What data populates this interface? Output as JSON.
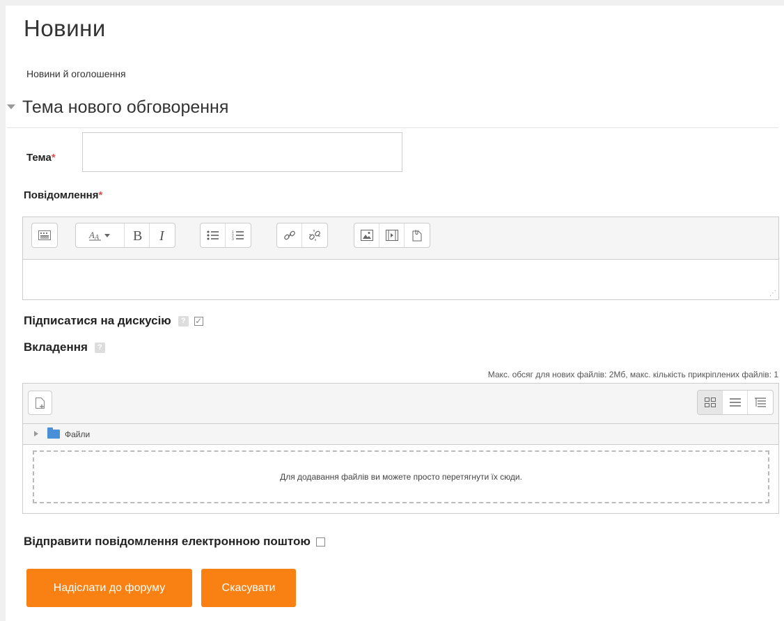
{
  "forum": {
    "title": "Новини",
    "subtitle": "Новини й оголошення"
  },
  "section": {
    "title": "Тема нового обговорення"
  },
  "form": {
    "topic_label": "Тема",
    "message_label": "Повідомлення",
    "required_marker": "*",
    "subscribe_label": "Підписатися на дискусію",
    "subscribe_checked": true,
    "attachments_label": "Вкладення",
    "email_label": "Відправити повідомлення електронною поштою",
    "email_checked": false,
    "help_glyph": "?"
  },
  "editor": {
    "toolbar_groups": [
      [
        "keyboard-icon"
      ],
      [
        "font-style-dropdown-icon",
        "bold-icon",
        "italic-icon"
      ],
      [
        "bullet-list-icon",
        "numbered-list-icon"
      ],
      [
        "link-icon",
        "unlink-icon"
      ],
      [
        "image-icon",
        "media-icon",
        "manage-files-icon"
      ]
    ]
  },
  "filemanager": {
    "limits_text": "Макс. обсяг для нових файлів: 2Мб, макс. кількість прикріплених файлів: 1",
    "folder_label": "Файли",
    "drop_text": "Для додавання файлів ви можете просто перетягнути їх сюди.",
    "view_buttons": [
      "icons-view-icon",
      "list-view-icon",
      "tree-view-icon"
    ]
  },
  "buttons": {
    "submit_label": "Надіслати до форуму",
    "cancel_label": "Скасувати"
  },
  "colors": {
    "accent": "#f98012",
    "required": "#d9534f",
    "folder": "#4a90d9"
  }
}
